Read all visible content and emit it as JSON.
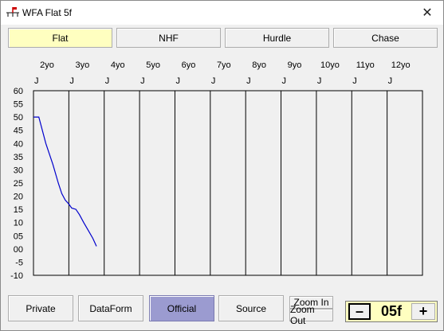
{
  "window": {
    "title": "WFA Flat 5f",
    "close_glyph": "✕",
    "icon": "horse-racing-icon"
  },
  "tabs": [
    {
      "label": "Flat",
      "selected": true
    },
    {
      "label": "NHF",
      "selected": false
    },
    {
      "label": "Hurdle",
      "selected": false
    },
    {
      "label": "Chase",
      "selected": false
    }
  ],
  "chart_data": {
    "type": "line",
    "age_labels": [
      "2yo",
      "3yo",
      "4yo",
      "5yo",
      "6yo",
      "7yo",
      "8yo",
      "9yo",
      "10yo",
      "11yo",
      "12yo"
    ],
    "month_markers": [
      "J",
      "J",
      "J",
      "J",
      "J",
      "J",
      "J",
      "J",
      "J",
      "J",
      "J"
    ],
    "y_ticks": [
      "60",
      "55",
      "50",
      "45",
      "40",
      "35",
      "30",
      "25",
      "20",
      "15",
      "10",
      "05",
      "00",
      "-5",
      "-10"
    ],
    "ylim": [
      -10,
      60
    ],
    "grid": true,
    "series": [
      {
        "color": "#0000cc",
        "x": [
          0.0,
          0.15,
          0.35,
          0.55,
          0.7,
          0.8,
          0.9,
          1.0,
          1.08,
          1.2,
          1.3,
          1.42,
          1.55,
          1.68,
          1.78
        ],
        "y": [
          50,
          50,
          40,
          32,
          25,
          21,
          18.5,
          17,
          15.5,
          15,
          13,
          10,
          7,
          4,
          1
        ]
      }
    ]
  },
  "bottom": {
    "private_label": "Private",
    "dataform_label": "DataForm",
    "official_label": "Official",
    "source_label": "Source",
    "zoom_in_label": "Zoom In",
    "zoom_out_label": "Zoom Out",
    "minus_label": "–",
    "distance_value": "05f",
    "plus_label": "+"
  },
  "colors": {
    "tab_selected": "#ffffc0",
    "official_selected": "#9b9bd0",
    "series_line": "#0000cc"
  }
}
